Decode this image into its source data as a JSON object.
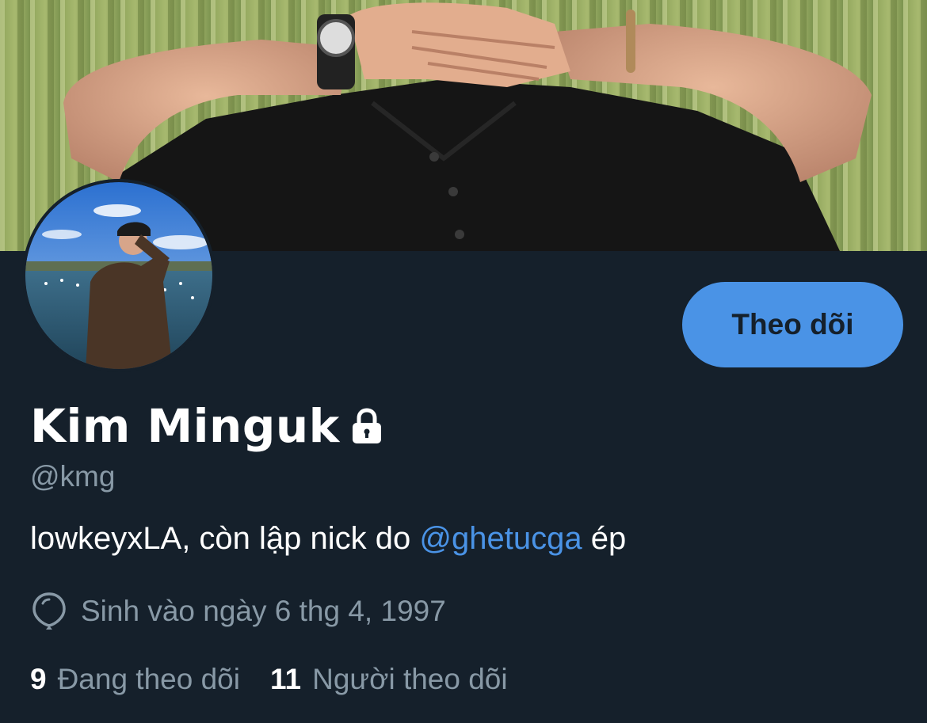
{
  "profile": {
    "display_name": "Kim Minguk",
    "handle": "@kmg",
    "bio_text": "lowkeyxLA, còn lập nick do ",
    "bio_mention": "@ghetucga",
    "bio_suffix": " ép",
    "birth": "Sinh vào ngày 6 thg 4, 1997",
    "protected": true
  },
  "actions": {
    "follow_label": "Theo dõi"
  },
  "stats": {
    "following_count": "9",
    "following_label": "Đang theo dõi",
    "followers_count": "11",
    "followers_label": "Người theo dõi"
  },
  "icons": {
    "lock": "lock-icon",
    "birthday": "balloon-icon"
  },
  "colors": {
    "background": "#15202b",
    "accent": "#4a93e6",
    "secondary_text": "#8899a6",
    "primary_text": "#ffffff"
  }
}
